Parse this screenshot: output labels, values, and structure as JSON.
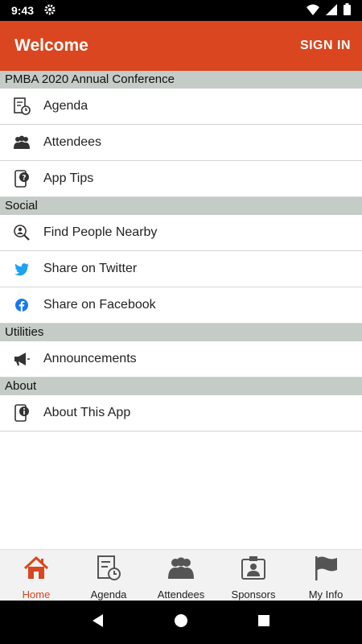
{
  "status_bar": {
    "time": "9:43"
  },
  "app_bar": {
    "title": "Welcome",
    "action": "SIGN IN"
  },
  "sections": [
    {
      "title": "PMBA 2020 Annual Conference",
      "items": [
        {
          "label": "Agenda",
          "icon": "agenda-icon"
        },
        {
          "label": "Attendees",
          "icon": "attendees-icon"
        },
        {
          "label": "App Tips",
          "icon": "app-tips-icon"
        }
      ]
    },
    {
      "title": "Social",
      "items": [
        {
          "label": "Find People Nearby",
          "icon": "find-people-icon"
        },
        {
          "label": "Share on Twitter",
          "icon": "twitter-icon"
        },
        {
          "label": "Share on Facebook",
          "icon": "facebook-icon"
        }
      ]
    },
    {
      "title": "Utilities",
      "items": [
        {
          "label": "Announcements",
          "icon": "megaphone-icon"
        }
      ]
    },
    {
      "title": "About",
      "items": [
        {
          "label": "About This App",
          "icon": "info-icon"
        }
      ]
    }
  ],
  "tabs": [
    {
      "label": "Home",
      "icon": "home-icon",
      "active": true
    },
    {
      "label": "Agenda",
      "icon": "agenda-icon"
    },
    {
      "label": "Attendees",
      "icon": "attendees-icon"
    },
    {
      "label": "Sponsors",
      "icon": "sponsors-icon"
    },
    {
      "label": "My Info",
      "icon": "flag-icon"
    }
  ],
  "colors": {
    "accent": "#d9461f",
    "section_bg": "#c5cbc6",
    "twitter": "#1da1f2",
    "facebook": "#1877f2"
  }
}
